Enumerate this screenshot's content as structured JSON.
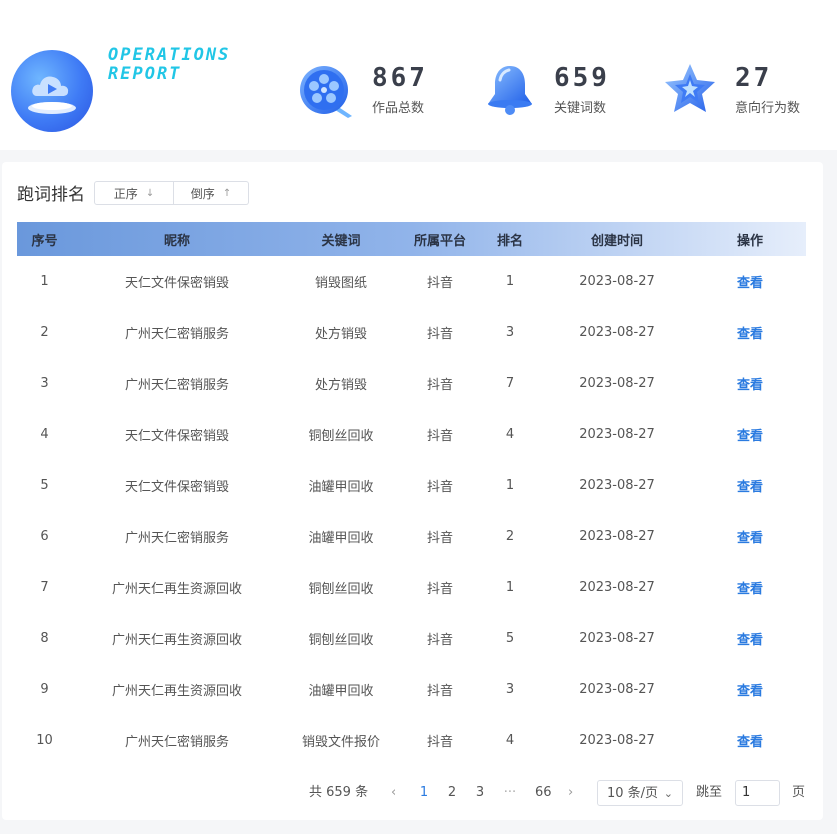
{
  "brand": {
    "line1": "OPERATIONS",
    "line2": "REPORT"
  },
  "stats": [
    {
      "value": "867",
      "label": "作品总数",
      "icon": "film-reel-icon"
    },
    {
      "value": "659",
      "label": "关键词数",
      "icon": "bell-icon"
    },
    {
      "value": "27",
      "label": "意向行为数",
      "icon": "star-icon"
    }
  ],
  "ranking": {
    "title": "跑词排名",
    "sort_asc": "正序",
    "sort_desc": "倒序",
    "columns": [
      "序号",
      "昵称",
      "关键词",
      "所属平台",
      "排名",
      "创建时间",
      "操作"
    ],
    "rows": [
      {
        "no": "1",
        "nickname": "天仁文件保密销毁",
        "keyword": "销毁图纸",
        "platform": "抖音",
        "rank": "1",
        "date": "2023-08-27",
        "action": "查看"
      },
      {
        "no": "2",
        "nickname": "广州天仁密销服务",
        "keyword": "处方销毁",
        "platform": "抖音",
        "rank": "3",
        "date": "2023-08-27",
        "action": "查看"
      },
      {
        "no": "3",
        "nickname": "广州天仁密销服务",
        "keyword": "处方销毁",
        "platform": "抖音",
        "rank": "7",
        "date": "2023-08-27",
        "action": "查看"
      },
      {
        "no": "4",
        "nickname": "天仁文件保密销毁",
        "keyword": "铜刨丝回收",
        "platform": "抖音",
        "rank": "4",
        "date": "2023-08-27",
        "action": "查看"
      },
      {
        "no": "5",
        "nickname": "天仁文件保密销毁",
        "keyword": "油罐甲回收",
        "platform": "抖音",
        "rank": "1",
        "date": "2023-08-27",
        "action": "查看"
      },
      {
        "no": "6",
        "nickname": "广州天仁密销服务",
        "keyword": "油罐甲回收",
        "platform": "抖音",
        "rank": "2",
        "date": "2023-08-27",
        "action": "查看"
      },
      {
        "no": "7",
        "nickname": "广州天仁再生资源回收",
        "keyword": "铜刨丝回收",
        "platform": "抖音",
        "rank": "1",
        "date": "2023-08-27",
        "action": "查看"
      },
      {
        "no": "8",
        "nickname": "广州天仁再生资源回收",
        "keyword": "铜刨丝回收",
        "platform": "抖音",
        "rank": "5",
        "date": "2023-08-27",
        "action": "查看"
      },
      {
        "no": "9",
        "nickname": "广州天仁再生资源回收",
        "keyword": "油罐甲回收",
        "platform": "抖音",
        "rank": "3",
        "date": "2023-08-27",
        "action": "查看"
      },
      {
        "no": "10",
        "nickname": "广州天仁密销服务",
        "keyword": "销毁文件报价",
        "platform": "抖音",
        "rank": "4",
        "date": "2023-08-27",
        "action": "查看"
      }
    ]
  },
  "pagination": {
    "total": "共 659 条",
    "pages": [
      "1",
      "2",
      "3",
      "···",
      "66"
    ],
    "current": "1",
    "page_size": "10 条/页",
    "jump_label": "跳至",
    "jump_value": "1",
    "page_suffix": "页"
  },
  "colors": {
    "accent": "#2b7be0",
    "brand": "#21c6e6",
    "header_start": "#6a98dc"
  }
}
